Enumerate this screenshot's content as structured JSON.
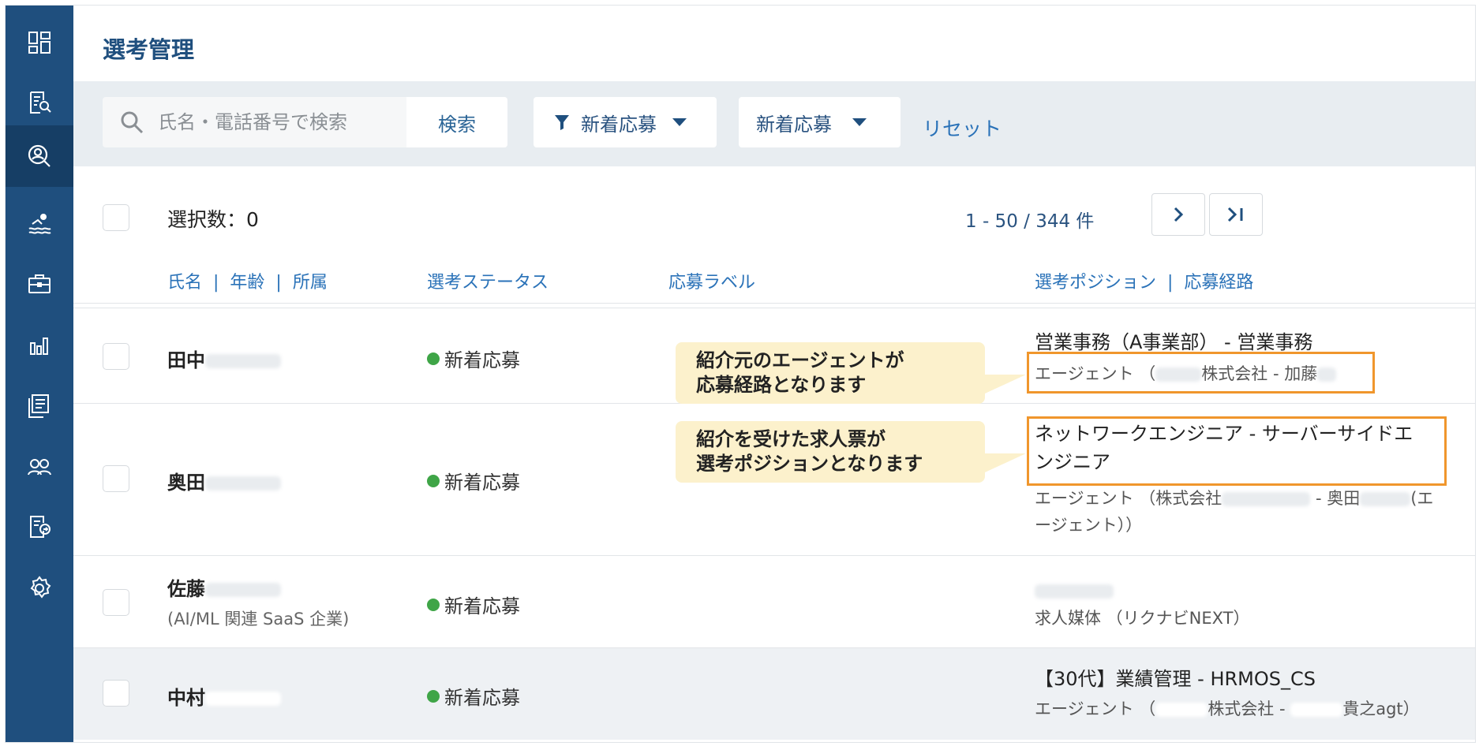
{
  "page_title": "選考管理",
  "search": {
    "placeholder": "氏名・電話番号で検索",
    "button_label": "検索"
  },
  "filters": {
    "status_filter": "新着応募",
    "sort_filter": "新着応募",
    "reset_label": "リセット"
  },
  "selection": {
    "count_text": "選択数：0"
  },
  "pagination": {
    "range_text": "1 - 50 / 344 件"
  },
  "columns": {
    "name": "氏名",
    "age": "年齢",
    "affiliation": "所属",
    "status": "選考ステータス",
    "label": "応募ラベル",
    "position": "選考ポジション",
    "route": "応募経路"
  },
  "rows": [
    {
      "name": "田中",
      "status": "新着応募",
      "position": "営業事務（A事業部） - 営業事務",
      "route_prefix": "エージェント （",
      "route_mid": "株式会社 - 加藤",
      "route_suffix": ""
    },
    {
      "name": "奥田",
      "status": "新着応募",
      "position_line1": "ネットワークエンジニア - サーバーサイドエ",
      "position_line2": "ンジニア",
      "route_prefix": "エージェント （株式会社",
      "route_mid": " - 奥田",
      "route_suffix": "(エ",
      "route_line2": "ージェント））"
    },
    {
      "name": "佐藤",
      "subtext": "(AI/ML 関連 SaaS 企業)",
      "status": "新着応募",
      "position": "",
      "route": "求人媒体 （リクナビNEXT）"
    },
    {
      "name": "中村",
      "status": "新着応募",
      "position": "【30代】業績管理 - HRMOS_CS",
      "route_prefix": "エージェント （",
      "route_mid": "株式会社 - ",
      "route_suffix": "貴之agt）"
    }
  ],
  "callouts": {
    "first_line1": "紹介元のエージェントが",
    "first_line2": "応募経路となります",
    "second_line1": "紹介を受けた求人票が",
    "second_line2": "選考ポジションとなります"
  },
  "colors": {
    "sidebar": "#1f4f7e",
    "accent": "#2a72b8",
    "highlight": "#f0962c",
    "status_dot": "#3fa547",
    "callout_bg": "#fcf1cc"
  },
  "sidebar_icons": [
    "dashboard-icon",
    "document-search-icon",
    "candidate-search-icon",
    "swimmer-icon",
    "briefcase-icon",
    "bar-chart-icon",
    "forms-icon",
    "users-icon",
    "export-icon",
    "gear-icon"
  ]
}
